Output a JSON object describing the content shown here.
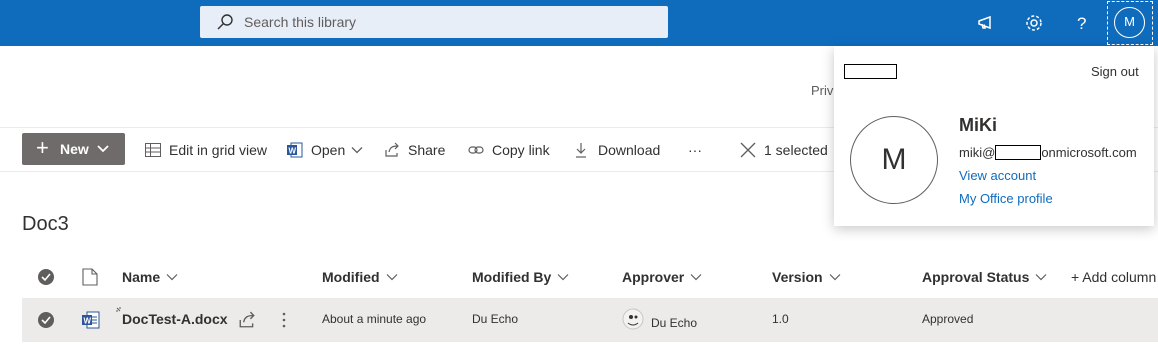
{
  "topbar": {
    "search_placeholder": "Search this library",
    "avatar_initial": "M",
    "icons": [
      "search-icon",
      "megaphone-icon",
      "gear-icon",
      "help-icon"
    ]
  },
  "background_text": {
    "privacy_partial": "Priv"
  },
  "commandbar": {
    "new_label": "New",
    "edit_grid_label": "Edit in grid view",
    "open_label": "Open",
    "share_label": "Share",
    "copy_link_label": "Copy link",
    "download_label": "Download",
    "more_label": "···",
    "selected_label": "1 selected"
  },
  "library": {
    "title": "Doc3"
  },
  "table": {
    "columns": {
      "name": "Name",
      "modified": "Modified",
      "modified_by": "Modified By",
      "approver": "Approver",
      "version": "Version",
      "approval_status": "Approval Status",
      "add_column": "+ Add column"
    },
    "rows": [
      {
        "name": "DocTest-A.docx",
        "modified": "About a minute ago",
        "modified_by": "Du Echo",
        "approver": "Du Echo",
        "version": "1.0",
        "approval_status": "Approved"
      }
    ]
  },
  "profile_panel": {
    "sign_out_label": "Sign out",
    "avatar_initial": "M",
    "user_name": "MiKi",
    "email_prefix": "miki@",
    "email_suffix": "onmicrosoft.com",
    "view_account_label": "View account",
    "office_profile_label": "My Office profile"
  },
  "colors": {
    "brand_blue": "#0f6cbd",
    "new_button": "#6e6b6a",
    "selected_row": "#edebe9",
    "link": "#0f6cbd"
  }
}
